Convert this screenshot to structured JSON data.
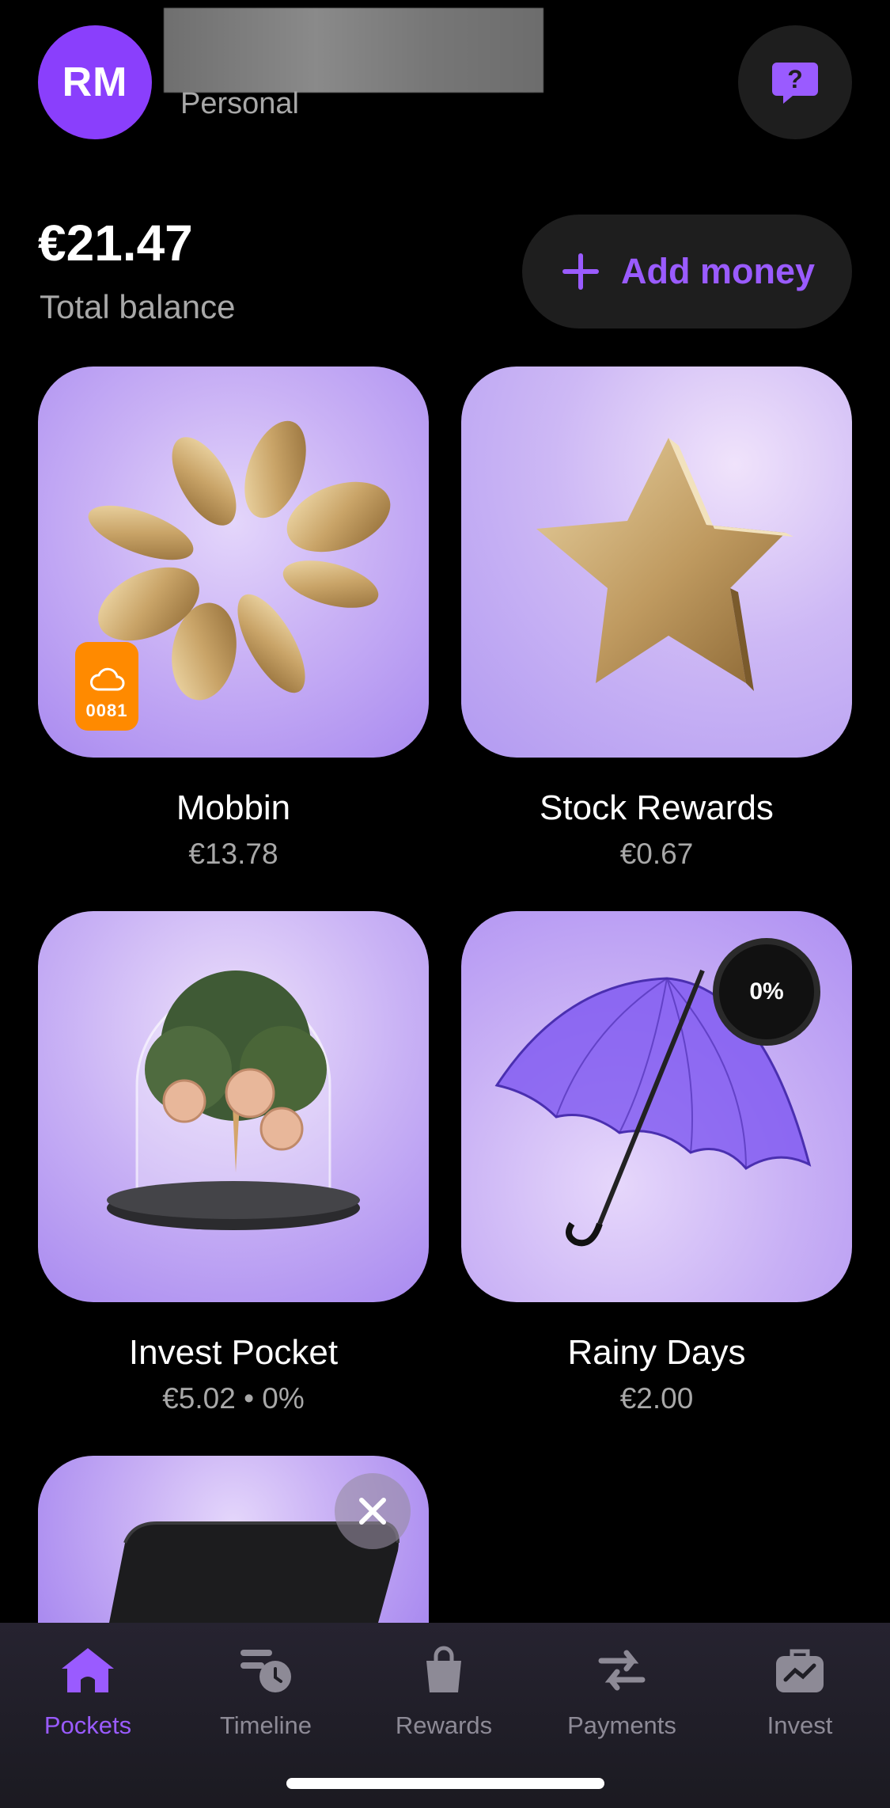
{
  "header": {
    "avatar_initials": "RM",
    "account_type": "Personal"
  },
  "balance": {
    "amount": "€21.47",
    "label": "Total balance",
    "add_money_label": "Add money"
  },
  "pockets": [
    {
      "name": "Mobbin",
      "amount": "€13.78",
      "badge": "0081"
    },
    {
      "name": "Stock Rewards",
      "amount": "€0.67"
    },
    {
      "name": "Invest Pocket",
      "amount": "€5.02 • 0%"
    },
    {
      "name": "Rainy Days",
      "amount": "€2.00",
      "progress": "0%"
    }
  ],
  "tabs": [
    {
      "label": "Pockets",
      "icon": "home-icon",
      "active": true
    },
    {
      "label": "Timeline",
      "icon": "timeline-icon"
    },
    {
      "label": "Rewards",
      "icon": "bag-icon"
    },
    {
      "label": "Payments",
      "icon": "transfer-icon"
    },
    {
      "label": "Invest",
      "icon": "briefcase-icon"
    }
  ],
  "colors": {
    "accent": "#9a5bff",
    "badge": "#ff8a00",
    "background": "#000000"
  }
}
